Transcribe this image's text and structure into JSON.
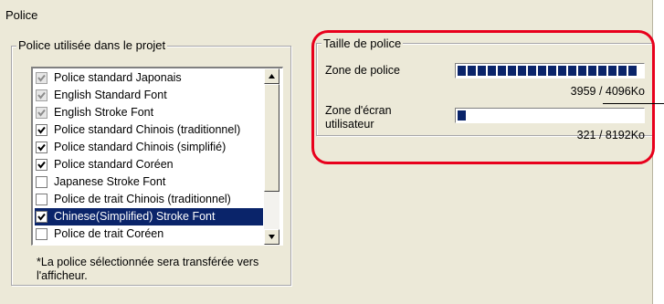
{
  "title": "Police",
  "font_group": {
    "legend": "Police utilisée dans le projet",
    "items": [
      {
        "label": "Police standard Japonais",
        "checked": true,
        "disabled": true,
        "selected": false
      },
      {
        "label": "English Standard Font",
        "checked": true,
        "disabled": true,
        "selected": false
      },
      {
        "label": "English Stroke Font",
        "checked": true,
        "disabled": true,
        "selected": false
      },
      {
        "label": "Police standard Chinois (traditionnel)",
        "checked": true,
        "disabled": false,
        "selected": false
      },
      {
        "label": "Police standard Chinois (simplifié)",
        "checked": true,
        "disabled": false,
        "selected": false
      },
      {
        "label": "Police standard Coréen",
        "checked": true,
        "disabled": false,
        "selected": false
      },
      {
        "label": "Japanese Stroke Font",
        "checked": false,
        "disabled": false,
        "selected": false
      },
      {
        "label": "Police de trait Chinois (traditionnel)",
        "checked": false,
        "disabled": false,
        "selected": false
      },
      {
        "label": "Chinese(Simplified) Stroke Font",
        "checked": true,
        "disabled": false,
        "selected": true
      },
      {
        "label": "Police de trait Coréen",
        "checked": false,
        "disabled": false,
        "selected": false
      }
    ],
    "note": "*La police sélectionnée sera transférée vers l'afficheur."
  },
  "size_group": {
    "legend": "Taille de police",
    "font_area": {
      "label": "Zone de police",
      "used": 3959,
      "total": 4096,
      "text": "3959 / 4096Ko"
    },
    "user_area": {
      "label": "Zone d'écran utilisateur",
      "used": 321,
      "total": 8192,
      "text": "321 / 8192Ko"
    }
  },
  "colors": {
    "highlight": "#e8001c",
    "bar_fill": "#0a246a",
    "selection": "#0a246a"
  },
  "icons": {
    "scroll_up": "triangle-up-icon",
    "scroll_down": "triangle-down-icon",
    "check": "check-mark-icon"
  }
}
